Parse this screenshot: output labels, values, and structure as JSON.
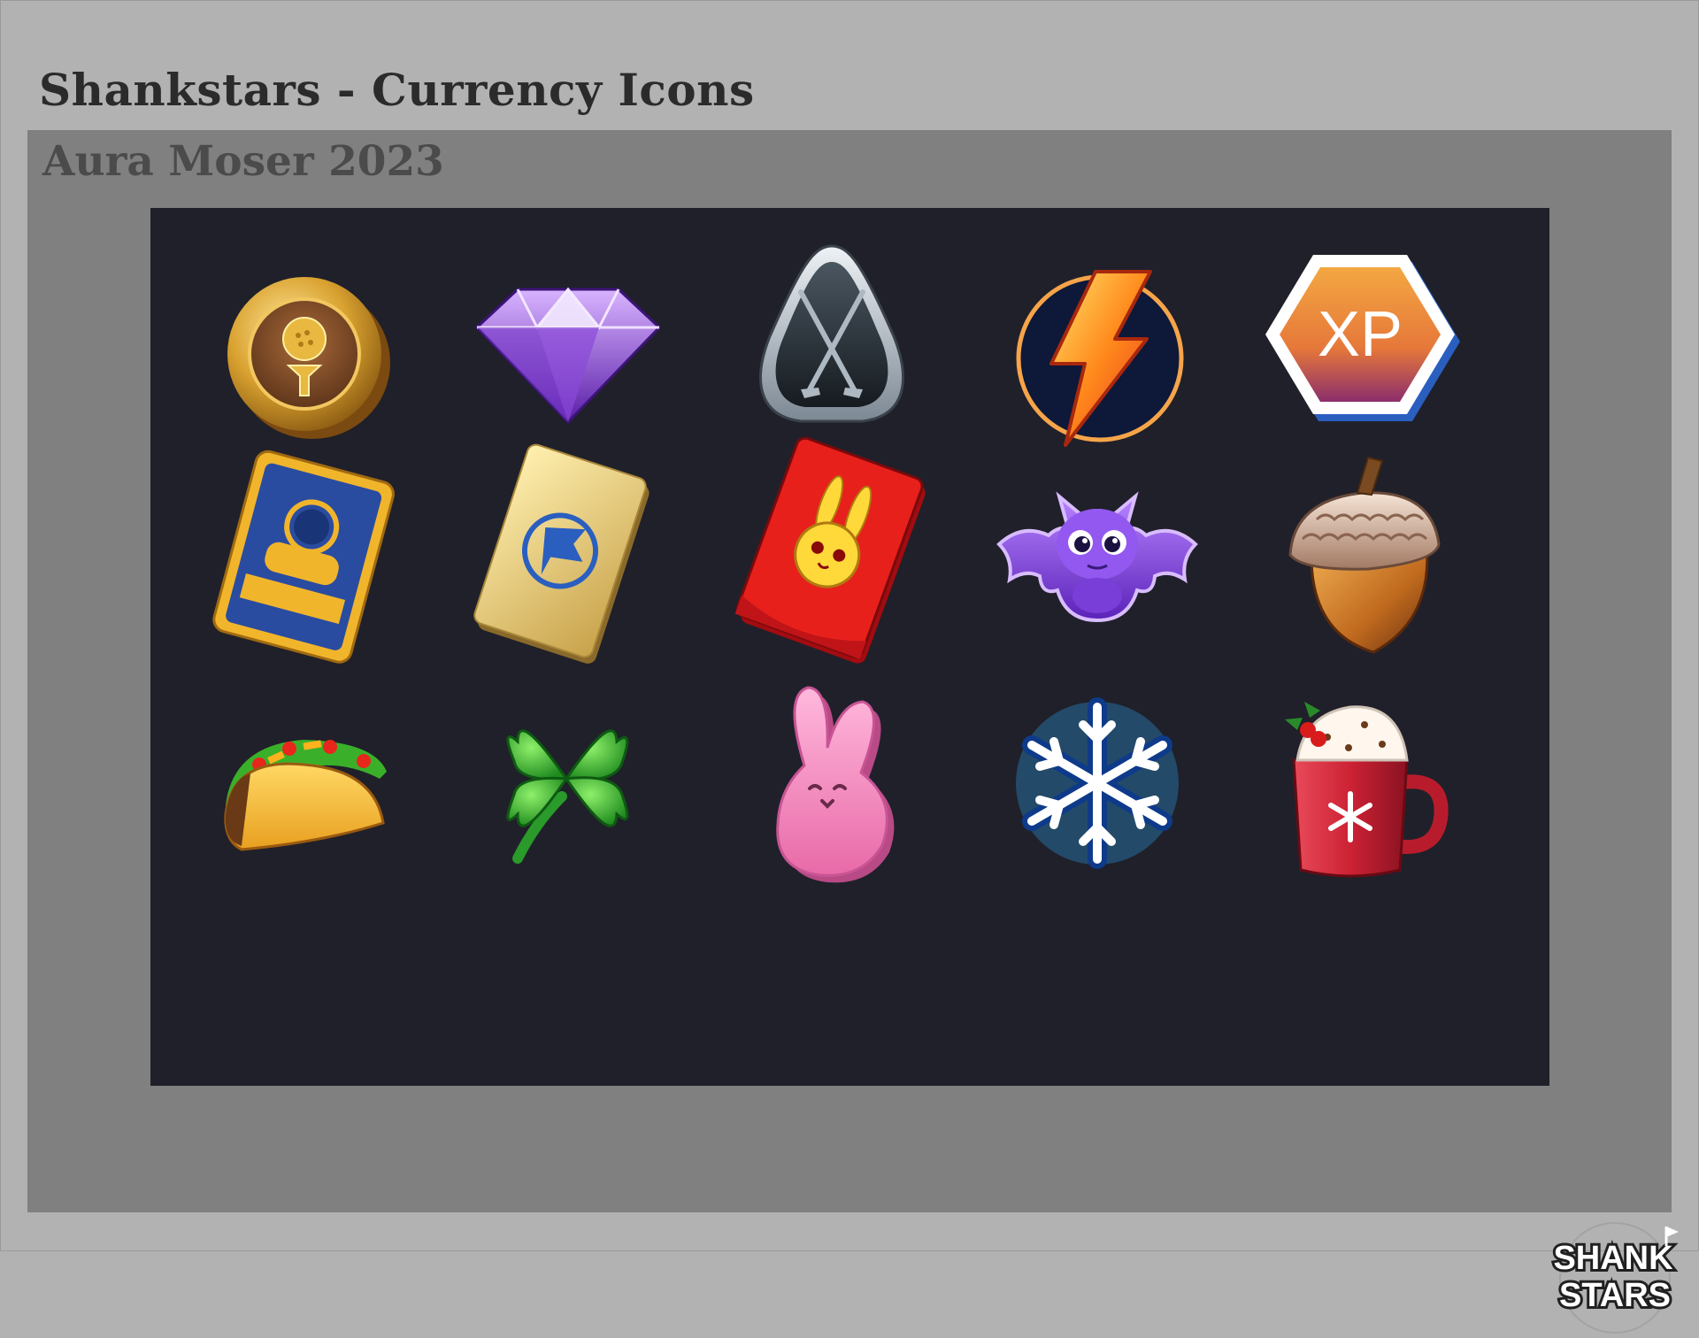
{
  "header": {
    "title": "Shankstars - Currency Icons"
  },
  "panel": {
    "author_year": "Aura Moser 2023"
  },
  "icons": [
    {
      "row": 1,
      "col": 1,
      "name": "gold-coin-icon"
    },
    {
      "row": 1,
      "col": 2,
      "name": "purple-gem-icon"
    },
    {
      "row": 1,
      "col": 3,
      "name": "golf-clubs-badge-icon"
    },
    {
      "row": 1,
      "col": 4,
      "name": "lightning-energy-icon"
    },
    {
      "row": 1,
      "col": 5,
      "name": "xp-hexagon-icon",
      "text": "XP"
    },
    {
      "row": 2,
      "col": 1,
      "name": "player-card-icon"
    },
    {
      "row": 2,
      "col": 2,
      "name": "golden-ticket-icon"
    },
    {
      "row": 2,
      "col": 3,
      "name": "red-envelope-rabbit-icon"
    },
    {
      "row": 2,
      "col": 4,
      "name": "purple-bat-icon"
    },
    {
      "row": 2,
      "col": 5,
      "name": "acorn-icon"
    },
    {
      "row": 3,
      "col": 1,
      "name": "taco-icon"
    },
    {
      "row": 3,
      "col": 2,
      "name": "four-leaf-clover-icon"
    },
    {
      "row": 3,
      "col": 3,
      "name": "pink-bunny-marshmallow-icon"
    },
    {
      "row": 3,
      "col": 4,
      "name": "snowflake-icon"
    },
    {
      "row": 3,
      "col": 5,
      "name": "hot-cocoa-mug-icon"
    }
  ],
  "logo": {
    "line1": "SHANK",
    "line2": "STARS"
  },
  "colors": {
    "page_bg": "#b2b2b2",
    "panel_bg": "#808080",
    "board_bg": "#20202a",
    "title_text": "#2b2b2b",
    "author_text": "#4b4b4b"
  }
}
